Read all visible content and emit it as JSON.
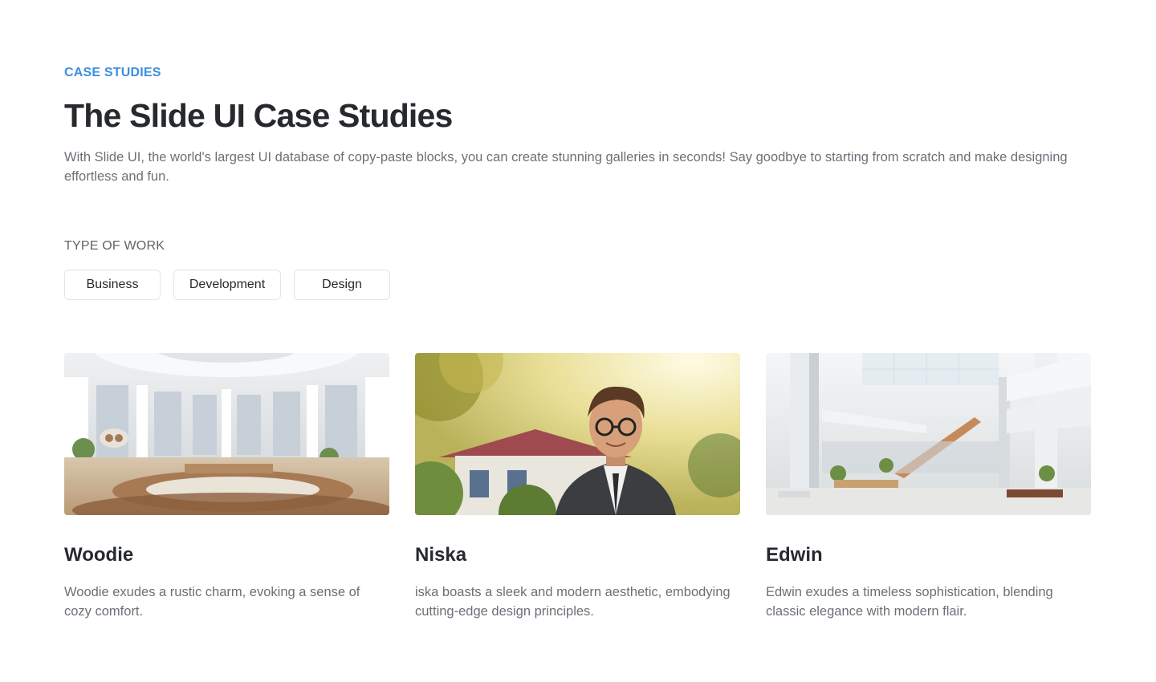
{
  "header": {
    "eyebrow": "CASE STUDIES",
    "title": "The Slide UI Case Studies",
    "description": "With Slide UI, the world's largest UI database of copy-paste blocks, you can create stunning galleries in seconds! Say goodbye to starting from scratch and make designing effortless and fun."
  },
  "filters": {
    "label": "TYPE OF WORK",
    "options": [
      "Business",
      "Development",
      "Design"
    ]
  },
  "cards": [
    {
      "title": "Woodie",
      "description": "Woodie exudes a rustic charm, evoking a sense of cozy comfort.",
      "image": "domed-assembly-hall-photo"
    },
    {
      "title": "Niska",
      "description": "iska boasts a sleek and modern aesthetic, embodying cutting-edge design principles.",
      "image": "smiling-man-with-glasses-portrait"
    },
    {
      "title": "Edwin",
      "description": "Edwin exudes a timeless sophistication, blending classic elegance with modern flair.",
      "image": "bright-atrium-interior-photo"
    }
  ],
  "colors": {
    "accent": "#3b8fe0",
    "heading": "#26292d",
    "body": "#6b7077"
  }
}
